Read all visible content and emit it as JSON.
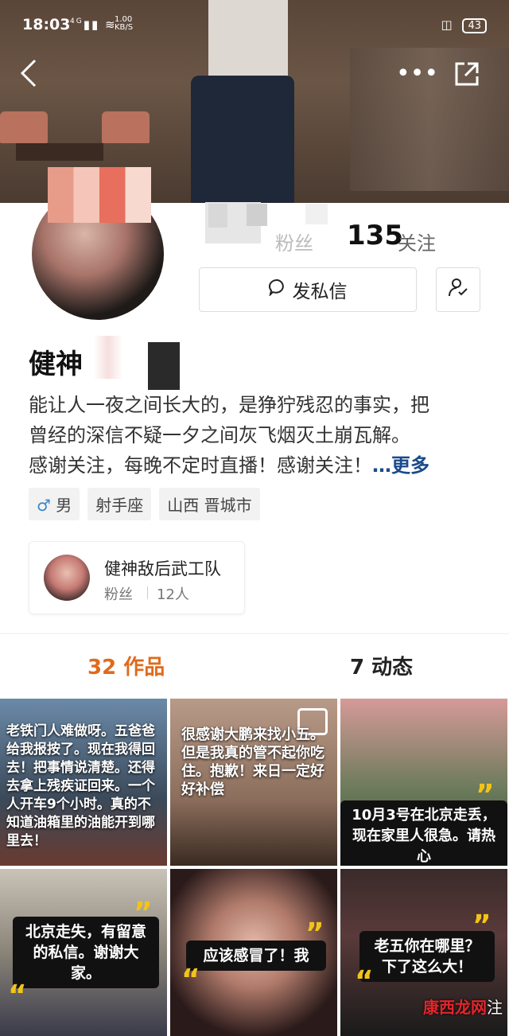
{
  "status_bar": {
    "time": "18:03",
    "signal": "4G",
    "speed": "1.00\nKB/S",
    "battery": "43"
  },
  "header": {
    "back_icon": "chevron-left-icon",
    "more_icon": "ellipsis-icon",
    "share_icon": "share-icon"
  },
  "stats": {
    "followers_label": "粉丝",
    "following_count": "135",
    "following_label": "关注"
  },
  "actions": {
    "message_label": "发私信",
    "message_icon": "chat-bubble-icon",
    "follow_icon": "user-check-icon"
  },
  "profile": {
    "nickname": "健神",
    "bio_line1": "能让人一夜之间长大的，是狰狞残忍的事实，把",
    "bio_line2": "曾经的深信不疑一夕之间灰飞烟灭土崩瓦解。",
    "bio_line3": "感谢关注，每晚不定时直播！感谢关注！",
    "bio_more": "…更多",
    "tags": {
      "gender_symbol": "♂",
      "gender": "男",
      "zodiac": "射手座",
      "location": "山西 晋城市"
    }
  },
  "fan_group": {
    "name": "健神敌后武工队",
    "label": "粉丝",
    "count": "12人"
  },
  "tabs": {
    "works": "32 作品",
    "moments": "7 动态"
  },
  "grid": {
    "cell1_caption": "老铁门人难做呀。五爸爸给我报按了。现在我得回去！把事情说清楚。还得去拿上残疾证回来。一个人开车9个小时。真的不知道油箱里的油能开到哪里去！",
    "cell2_caption": "很感谢大鹏来找小五。但是我真的管不起你吃住。抱歉！来日一定好好补偿",
    "cell3_caption": "10月3号在北京走丢，现在家里人很急。请热心",
    "cell4_caption": "北京走失，有留意的私信。谢谢大家。",
    "cell5_caption": "应该感冒了！我",
    "cell6_caption": "老五你在哪里？下了这么大！"
  },
  "watermark": {
    "red": "康西龙网",
    "tail": "注"
  },
  "colors": {
    "accent": "#e06a1b",
    "more_link": "#1a4a8a",
    "male_icon": "#3a86c8",
    "caption_yellow": "#f3c418"
  }
}
